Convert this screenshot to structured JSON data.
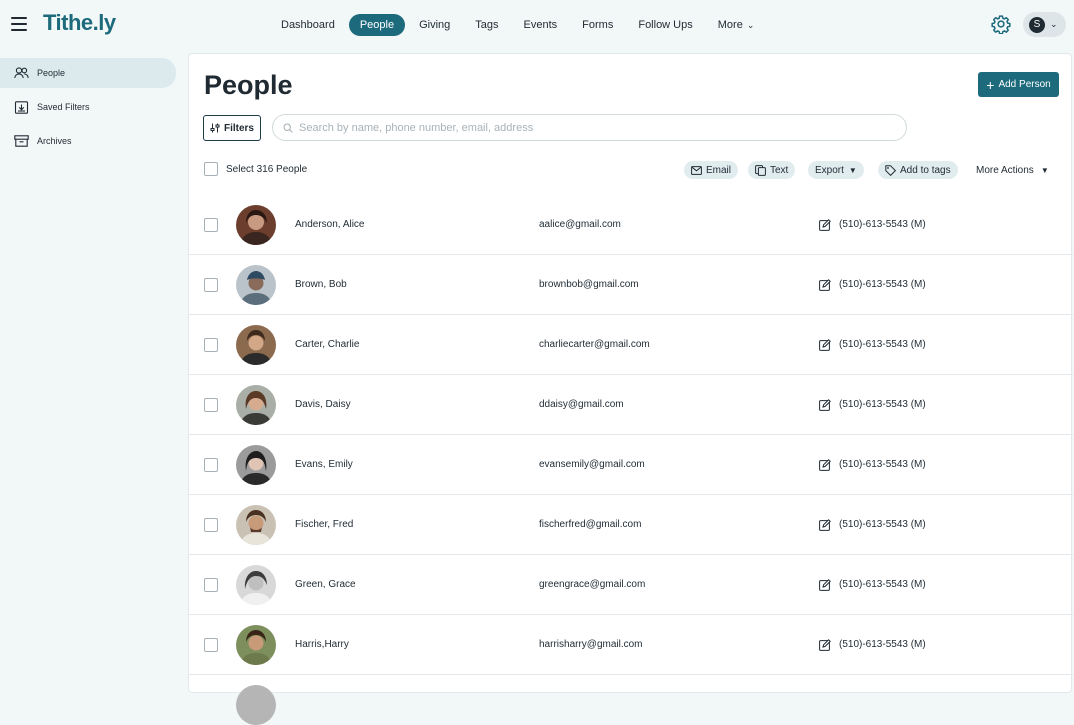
{
  "app": {
    "logo": "Tithe.ly"
  },
  "nav": {
    "items": [
      {
        "label": "Dashboard",
        "active": false
      },
      {
        "label": "People",
        "active": true
      },
      {
        "label": "Giving",
        "active": false
      },
      {
        "label": "Tags",
        "active": false
      },
      {
        "label": "Events",
        "active": false
      },
      {
        "label": "Forms",
        "active": false
      },
      {
        "label": "Follow Ups",
        "active": false
      },
      {
        "label": "More",
        "active": false
      }
    ],
    "avatar_initial": "S"
  },
  "sidebar": {
    "items": [
      {
        "label": "People",
        "icon": "people-icon",
        "active": true
      },
      {
        "label": "Saved Filters",
        "icon": "saved-filters-icon",
        "active": false
      },
      {
        "label": "Archives",
        "icon": "archive-icon",
        "active": false
      }
    ]
  },
  "main": {
    "title": "People",
    "add_person_label": "Add Person",
    "filters_label": "Filters",
    "search_placeholder": "Search by name, phone number, email, address",
    "select_all_label": "Select 316 People",
    "actions": {
      "email": "Email",
      "text": "Text",
      "export": "Export",
      "add_to_tags": "Add to tags",
      "more_actions": "More Actions"
    }
  },
  "people": [
    {
      "name": "Anderson, Alice",
      "email": "aalice@gmail.com",
      "phone": "(510)-613-5543 (M)"
    },
    {
      "name": "Brown, Bob",
      "email": "brownbob@gmail.com",
      "phone": "(510)-613-5543 (M)"
    },
    {
      "name": "Carter, Charlie",
      "email": "charliecarter@gmail.com",
      "phone": "(510)-613-5543 (M)"
    },
    {
      "name": "Davis, Daisy",
      "email": "ddaisy@gmail.com",
      "phone": "(510)-613-5543 (M)"
    },
    {
      "name": "Evans, Emily",
      "email": "evansemily@gmail.com",
      "phone": "(510)-613-5543 (M)"
    },
    {
      "name": "Fischer, Fred",
      "email": "fischerfred@gmail.com",
      "phone": "(510)-613-5543 (M)"
    },
    {
      "name": "Green, Grace",
      "email": "greengrace@gmail.com",
      "phone": "(510)-613-5543 (M)"
    },
    {
      "name": "Harris,Harry",
      "email": "harrisharry@gmail.com",
      "phone": "(510)-613-5543 (M)"
    }
  ],
  "colors": {
    "brand": "#1d6a7c",
    "background": "#f2f7f7",
    "sidebar_active": "#dceaee",
    "action_pill": "#e1ecef"
  }
}
